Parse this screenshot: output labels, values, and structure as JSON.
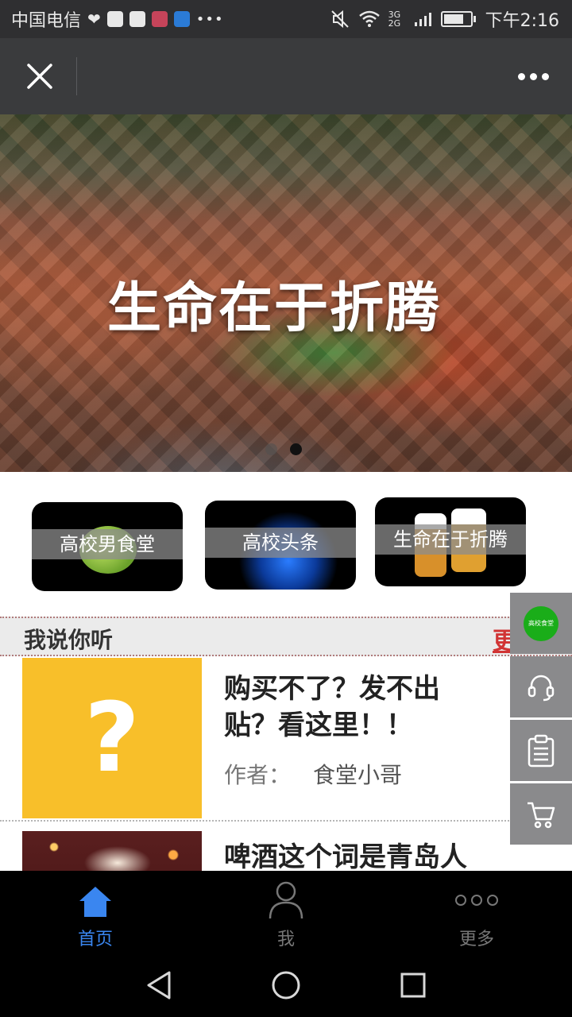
{
  "status_bar": {
    "carrier": "中国电信",
    "network": "3G 2G",
    "time": "下午2:16"
  },
  "banner": {
    "headline": "生命在于折腾",
    "slide_count": 2,
    "active_slide": 2
  },
  "categories": [
    {
      "label": "高校男食堂"
    },
    {
      "label": "高校头条"
    },
    {
      "label": "生命在于折腾"
    }
  ],
  "section": {
    "title": "我说你听",
    "more_label": "更多"
  },
  "articles": [
    {
      "title": "购买不了？发不出贴？看这里！！",
      "author_prefix": "作者：",
      "author": "食堂小哥",
      "thumb_glyph": "?"
    },
    {
      "title": "啤酒这个词是青岛人"
    }
  ],
  "side_float": {
    "badge_text": "高校食堂"
  },
  "tabs": [
    {
      "label": "首页",
      "active": true
    },
    {
      "label": "我",
      "active": false
    },
    {
      "label": "更多",
      "active": false
    }
  ],
  "colors": {
    "accent_blue": "#3a86f0",
    "more_red": "#d13434",
    "thumb_yellow": "#f8bf2a",
    "wechat_green": "#1aad19"
  }
}
